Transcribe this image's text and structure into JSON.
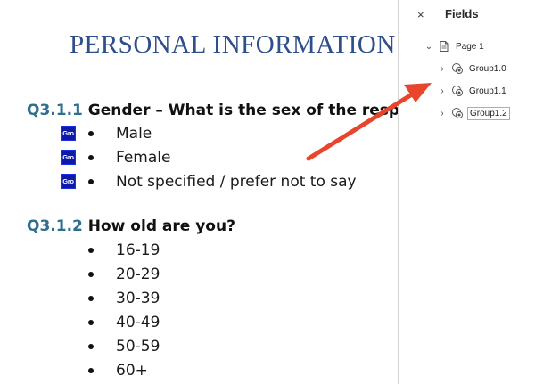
{
  "document": {
    "title": "PERSONAL INFORMATION",
    "q1": {
      "number": "Q3.1.1",
      "text": " Gender – What is the sex of the respondent?",
      "field_icon_label": "Gro",
      "options": [
        "Male",
        "Female",
        "Not specified / prefer not to say"
      ]
    },
    "q2": {
      "number": "Q3.1.2",
      "text": " How old are you?",
      "options": [
        "16-19",
        "20-29",
        "30-39",
        "40-49",
        "50-59",
        "60+"
      ]
    }
  },
  "panel": {
    "close_icon": "close-icon",
    "close_glyph": "×",
    "title": "Fields",
    "tree": {
      "page": {
        "label": "Page 1",
        "expanded": true,
        "icon": "page-icon"
      },
      "groups": [
        {
          "label": "Group1.0",
          "icon": "radio-group-icon",
          "selected": false
        },
        {
          "label": "Group1.1",
          "icon": "radio-group-icon",
          "selected": false
        },
        {
          "label": "Group1.2",
          "icon": "radio-group-icon",
          "selected": true
        }
      ]
    }
  },
  "annotation": {
    "arrow_color": "#e8462c",
    "accent": "#1b2ee8"
  }
}
